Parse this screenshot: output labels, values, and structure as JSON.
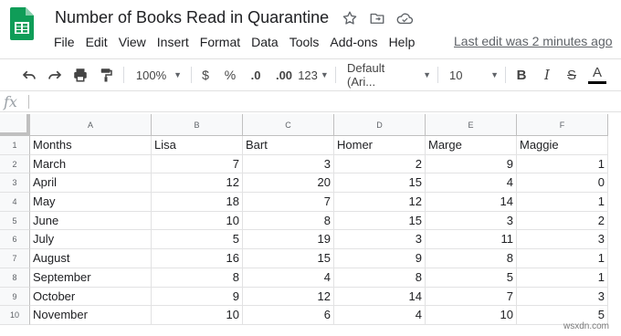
{
  "title": "Number of Books Read in Quarantine",
  "menu": [
    "File",
    "Edit",
    "View",
    "Insert",
    "Format",
    "Data",
    "Tools",
    "Add-ons",
    "Help"
  ],
  "last_edit": "Last edit was 2 minutes ago",
  "toolbar": {
    "zoom": "100%",
    "currency": "$",
    "percent": "%",
    "decimal_decrease": ".0",
    "decimal_increase": ".00",
    "more_formats": "123",
    "font": "Default (Ari...",
    "font_size": "10",
    "bold": "B",
    "italic": "I",
    "strikethrough": "S",
    "text_color": "A"
  },
  "formula_bar": {
    "fx": "fx"
  },
  "columns": [
    "A",
    "B",
    "C",
    "D",
    "E",
    "F"
  ],
  "row_numbers": [
    "1",
    "2",
    "3",
    "4",
    "5",
    "6",
    "7",
    "8",
    "9",
    "10"
  ],
  "header_row": [
    "Months",
    "Lisa",
    "Bart",
    "Homer",
    "Marge",
    "Maggie"
  ],
  "rows": [
    [
      "March",
      "7",
      "3",
      "2",
      "9",
      "1"
    ],
    [
      "April",
      "12",
      "20",
      "15",
      "4",
      "0"
    ],
    [
      "May",
      "18",
      "7",
      "12",
      "14",
      "1"
    ],
    [
      "June",
      "10",
      "8",
      "15",
      "3",
      "2"
    ],
    [
      "July",
      "5",
      "19",
      "3",
      "11",
      "3"
    ],
    [
      "August",
      "16",
      "15",
      "9",
      "8",
      "1"
    ],
    [
      "September",
      "8",
      "4",
      "8",
      "5",
      "1"
    ],
    [
      "October",
      "9",
      "12",
      "14",
      "7",
      "3"
    ],
    [
      "November",
      "10",
      "6",
      "4",
      "10",
      "5"
    ]
  ],
  "watermark": "wsxdn.com",
  "colors": {
    "sheets_green": "#0f9d58",
    "text": "#202124",
    "grid_line": "#e2e2e3"
  }
}
